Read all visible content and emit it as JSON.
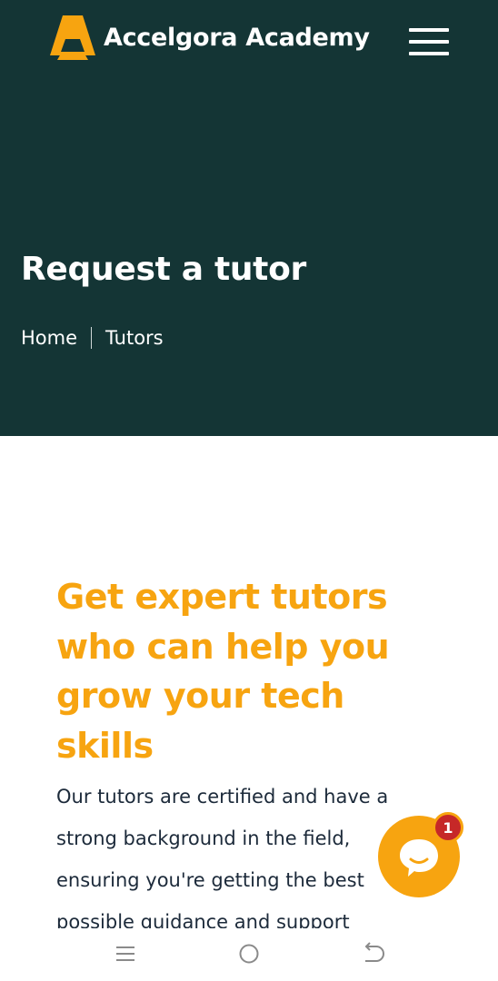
{
  "header": {
    "brand_name": "Accelgora Academy",
    "logo_icon": "accelgora-a-logo-icon",
    "menu_icon": "hamburger-menu-icon"
  },
  "hero": {
    "title": "Request a tutor",
    "breadcrumb": [
      {
        "label": "Home"
      },
      {
        "label": "Tutors"
      }
    ]
  },
  "content": {
    "headline": "Get expert tutors who can help you grow your tech skills",
    "body": "Our tutors are certified and have a strong background in the field, ensuring you're getting the best possible guidance and support"
  },
  "chat_widget": {
    "icon": "chat-bubble-icon",
    "badge_count": "1"
  },
  "system_nav": {
    "buttons": [
      "recent-apps-icon",
      "home-circle-icon",
      "back-icon"
    ]
  },
  "colors": {
    "hero_background": "#143535",
    "accent": "#f7a410",
    "body_text": "#1c2a3a",
    "badge": "#c62828"
  }
}
